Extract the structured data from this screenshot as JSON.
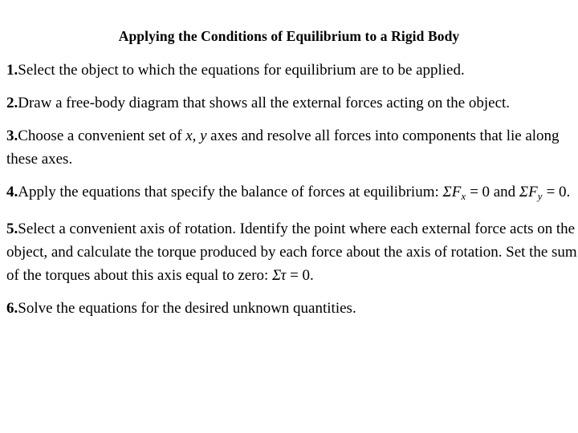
{
  "slide": {
    "title": "Applying the Conditions of Equilibrium to a Rigid Body",
    "background_color": "#ffffff",
    "text_color": "#000000",
    "steps": [
      {
        "number": "1.",
        "text": "Select the object to which the equations for equilibrium are to be applied."
      },
      {
        "number": "2.",
        "text": "Draw a free-body diagram that shows all the external forces acting on the object."
      },
      {
        "number": "3.",
        "text_before_italic": "Choose a convenient set of ",
        "italic_x": "x",
        "text_comma": ", ",
        "italic_y": "y",
        "text_after_italic": " axes and resolve all forces into components that lie along these axes."
      },
      {
        "number": "4.",
        "text_before_eq": "Apply the equations that specify the balance of forces at equilibrium: ",
        "eq_sigma_1": "Σ",
        "eq_f_1": "F",
        "eq_sub_1": "x",
        "eq_equals_1": " = 0",
        "eq_conjunction": " and ",
        "eq_sigma_2": "Σ",
        "eq_f_2": "F",
        "eq_sub_2": "y",
        "eq_equals_2": " = 0",
        "eq_period": "."
      },
      {
        "number": "5.",
        "text_before_eq": "Select a convenient axis of rotation. Identify the point where each external force acts on the object, and calculate the torque produced by each force about the axis of rotation. Set the sum of the torques about this axis equal to zero: ",
        "eq_sigma": "Σ",
        "eq_tau": "τ",
        "eq_equals": " = 0",
        "eq_period": "."
      },
      {
        "number": "6.",
        "text": "Solve the equations for the desired unknown quantities."
      }
    ]
  }
}
